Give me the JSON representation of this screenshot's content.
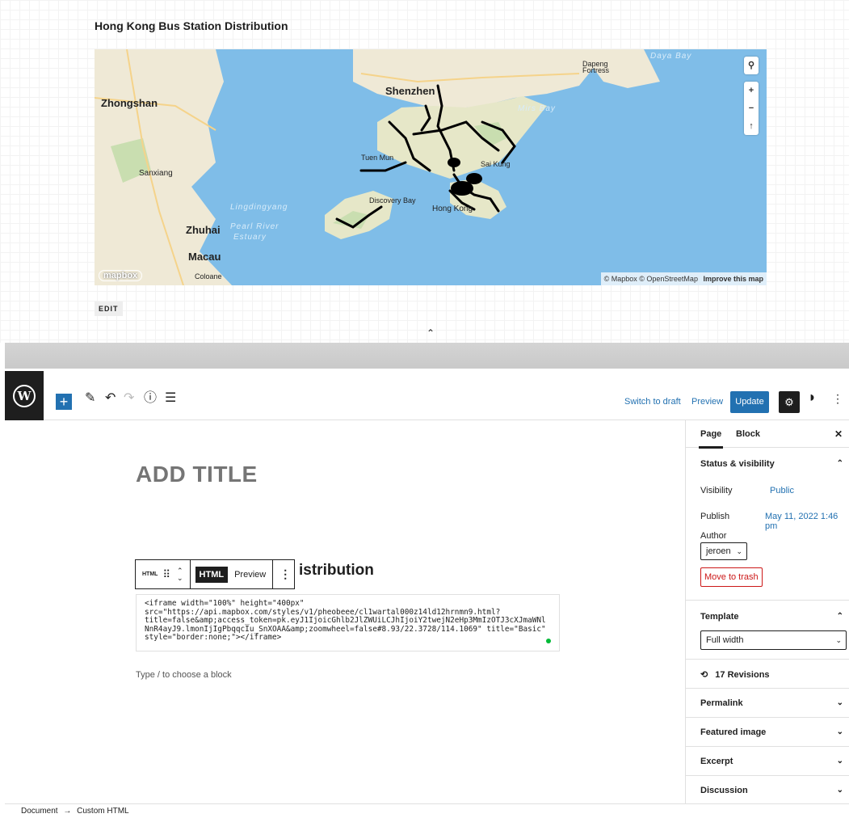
{
  "preview": {
    "title": "Hong Kong Bus Station Distribution",
    "map_labels": {
      "shenzhen": "Shenzhen",
      "zhongshan": "Zhongshan",
      "sanxiang": "Sanxiang",
      "zhuhai": "Zhuhai",
      "macau": "Macau",
      "coloane": "Coloane",
      "dapeng": "Dapeng",
      "fortress": "Fortress",
      "daya_bay": "Daya Bay",
      "mirs_bay": "Mirs Bay",
      "lingding": "Lingdingyang",
      "pearl_river": "Pearl River",
      "estuary": "Estuary",
      "tuen_mun": "Tuen Mun",
      "discovery_bay": "Discovery Bay",
      "sai_kung": "Sai Kung",
      "hong_kong": "Hong Kong"
    },
    "attribution": "© Mapbox © OpenStreetMap",
    "improve_link": "Improve this map",
    "mapbox_logo": "mapbox",
    "controls": {
      "search": "⚲",
      "zoom_in": "+",
      "zoom_out": "−",
      "compass": "↑"
    },
    "edit_label": "EDIT",
    "collapse": "⌃"
  },
  "toolbar": {
    "switch_to_draft": "Switch to draft",
    "preview": "Preview",
    "update": "Update",
    "icons": [
      "wordpress-icon",
      "add-block-icon",
      "pencil-icon",
      "undo-icon",
      "redo-icon",
      "info-icon",
      "list-view-icon",
      "gear-icon",
      "plugin-icon",
      "more-icon"
    ]
  },
  "canvas": {
    "title_placeholder": "ADD TITLE",
    "block_type_tag": "HTML",
    "tab_html": "HTML",
    "tab_preview": "Preview",
    "heading_visible": "istribution",
    "code": "<iframe width=\"100%\" height=\"400px\"\nsrc=\"https://api.mapbox.com/styles/v1/pheobeee/cl1wartal000z14ld12hrnmn9.html?\ntitle=false&amp;access_token=pk.eyJ1IjoicGhlb2JlZWUiLCJhIjoiY2twejN2eHp3MmIzOTJ3cXJmaWNl\nNnR4ayJ9.lmonIjIgPbqqcIu_SnXOAA&amp;zoomwheel=false#8.93/22.3728/114.1069\" title=\"Basic\"\nstyle=\"border:none;\"></iframe>",
    "block_placeholder": "Type / to choose a block"
  },
  "sidebar": {
    "tab_page": "Page",
    "tab_block": "Block",
    "status_title": "Status & visibility",
    "visibility_label": "Visibility",
    "visibility_value": "Public",
    "publish_label": "Publish",
    "publish_value": "May 11, 2022 1:46 pm",
    "author_label": "Author",
    "author_value": "jeroen",
    "move_to_trash": "Move to trash",
    "template_title": "Template",
    "template_value": "Full width",
    "revisions": "17 Revisions",
    "permalink": "Permalink",
    "featured_image": "Featured image",
    "excerpt": "Excerpt",
    "discussion": "Discussion"
  },
  "footer": {
    "crumb_document": "Document",
    "arrow": "→",
    "crumb_block": "Custom HTML"
  },
  "colors": {
    "accent": "#2271b1",
    "water": "#7fbde8",
    "land": "#f2eee0",
    "danger": "#cc1818"
  }
}
